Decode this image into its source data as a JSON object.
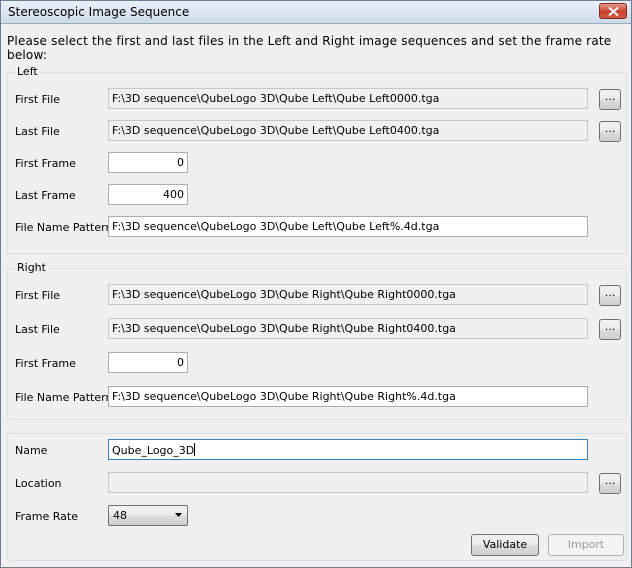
{
  "window": {
    "title": "Stereoscopic Image Sequence"
  },
  "instructions": "Please select the first and last files in the Left and Right image sequences and set the frame rate below:",
  "left": {
    "group_label": "Left",
    "first_file_label": "First File",
    "first_file_value": "F:\\3D sequence\\QubeLogo 3D\\Qube Left\\Qube Left0000.tga",
    "last_file_label": "Last File",
    "last_file_value": "F:\\3D sequence\\QubeLogo 3D\\Qube Left\\Qube Left0400.tga",
    "first_frame_label": "First Frame",
    "first_frame_value": "0",
    "last_frame_label": "Last Frame",
    "last_frame_value": "400",
    "pattern_label": "File Name Pattern",
    "pattern_value": "F:\\3D sequence\\QubeLogo 3D\\Qube Left\\Qube Left%.4d.tga"
  },
  "right": {
    "group_label": "Right",
    "first_file_label": "First File",
    "first_file_value": "F:\\3D sequence\\QubeLogo 3D\\Qube Right\\Qube Right0000.tga",
    "last_file_label": "Last File",
    "last_file_value": "F:\\3D sequence\\QubeLogo 3D\\Qube Right\\Qube Right0400.tga",
    "first_frame_label": "First Frame",
    "first_frame_value": "0",
    "pattern_label": "File Name Pattern",
    "pattern_value": "F:\\3D sequence\\QubeLogo 3D\\Qube Right\\Qube Right%.4d.tga"
  },
  "output": {
    "name_label": "Name",
    "name_value": "Qube_Logo_3D",
    "location_label": "Location",
    "location_value": "",
    "frame_rate_label": "Frame Rate",
    "frame_rate_value": "48"
  },
  "browse_label": "...",
  "buttons": {
    "validate": "Validate",
    "import": "Import"
  },
  "icons": {
    "close": "close-icon",
    "dropdown": "chevron-down-icon"
  }
}
